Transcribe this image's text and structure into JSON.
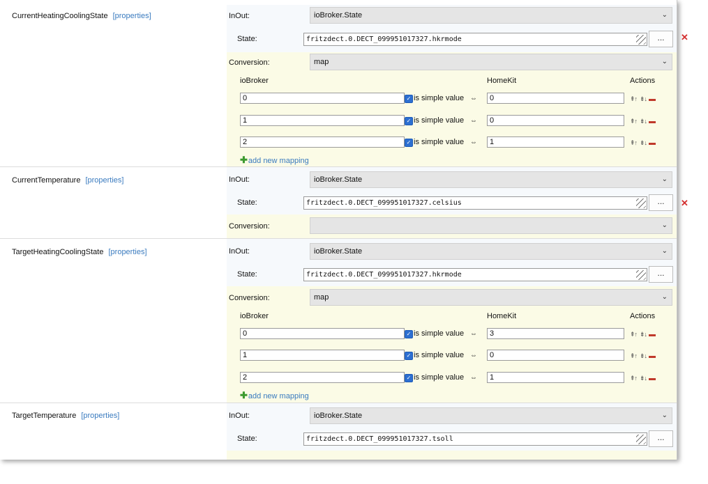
{
  "labels": {
    "inout": "InOut:",
    "state": "State:",
    "conversion": "Conversion:",
    "iobroker_head": "ioBroker",
    "homekit_head": "HomeKit",
    "actions_head": "Actions",
    "is_simple_value": "is simple value",
    "add_new_mapping": "add new mapping",
    "properties_link": "[properties]",
    "dots_button": "...",
    "arrow_symbol": "⇔",
    "move_up": "⇞↑",
    "move_down": "⇟↓"
  },
  "characteristics": [
    {
      "name": "CurrentHeatingCoolingState",
      "inout": "ioBroker.State",
      "state": "fritzdect.0.DECT_099951017327.hkrmode",
      "conversion": "map",
      "mappings": [
        {
          "iobroker": "0",
          "homekit": "0"
        },
        {
          "iobroker": "1",
          "homekit": "0"
        },
        {
          "iobroker": "2",
          "homekit": "1"
        }
      ]
    },
    {
      "name": "CurrentTemperature",
      "inout": "ioBroker.State",
      "state": "fritzdect.0.DECT_099951017327.celsius",
      "conversion": ""
    },
    {
      "name": "TargetHeatingCoolingState",
      "inout": "ioBroker.State",
      "state": "fritzdect.0.DECT_099951017327.hkrmode",
      "conversion": "map",
      "mappings": [
        {
          "iobroker": "0",
          "homekit": "3"
        },
        {
          "iobroker": "1",
          "homekit": "0"
        },
        {
          "iobroker": "2",
          "homekit": "1"
        }
      ]
    },
    {
      "name": "TargetTemperature",
      "inout": "ioBroker.State",
      "state": "fritzdect.0.DECT_099951017327.tsoll"
    }
  ],
  "colors": {
    "link": "#3a7bbf",
    "checkbox": "#2d6fd1",
    "delete": "#c0392b",
    "add_plus": "#3c9a2f",
    "conversion_band": "#fbfbe6"
  }
}
